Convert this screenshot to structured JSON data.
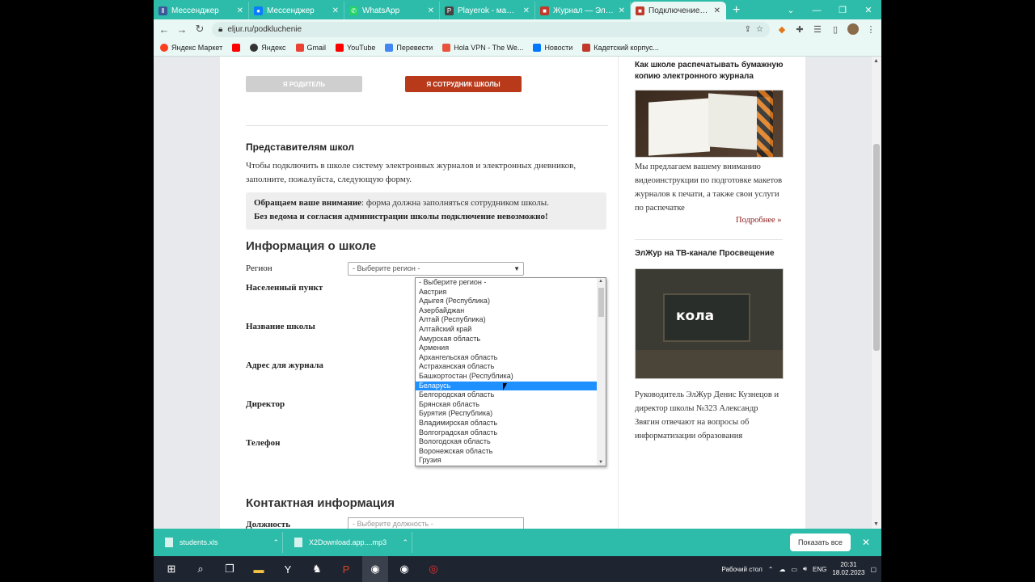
{
  "browser": {
    "tabs": [
      {
        "title": "Мессенджер",
        "color": "#3b5998"
      },
      {
        "title": "Мессенджер",
        "color": "#0a7cff"
      },
      {
        "title": "WhatsApp",
        "color": "#25d366"
      },
      {
        "title": "Playerok - маркетп",
        "color": "#444"
      },
      {
        "title": "Журнал — Электр",
        "color": "#c0392b"
      },
      {
        "title": "Подключение эле",
        "color": "#c0392b"
      }
    ],
    "url": "eljur.ru/podkluchenie",
    "bookmarks": [
      {
        "label": "Яндекс Маркет",
        "color": "#fc3f1d"
      },
      {
        "label": "",
        "color": "#ff0000"
      },
      {
        "label": "Яндекс",
        "color": "#333"
      },
      {
        "label": "Gmail",
        "color": "#ea4335"
      },
      {
        "label": "YouTube",
        "color": "#ff0000"
      },
      {
        "label": "Перевести",
        "color": "#4285f4"
      },
      {
        "label": "Hola VPN - The We...",
        "color": "#e8533b"
      },
      {
        "label": "Новости",
        "color": "#0077ff"
      },
      {
        "label": "Кадетский корпус...",
        "color": "#c0392b"
      }
    ]
  },
  "main": {
    "role_buttons": {
      "parent": "Я РОДИТЕЛЬ",
      "staff": "Я СОТРУДНИК ШКОЛЫ"
    },
    "reps_heading": "Представителям школ",
    "intro_text": "Чтобы подключить в школе систему электронных журналов и электронных дневников, заполните, пожалуйста, следующую форму.",
    "notice_bold": "Обращаем ваше внимание",
    "notice_text": ": форма должна заполняться сотрудником школы.",
    "notice_line2": "Без ведома и согласия администрации школы подключение невозможно!",
    "school_info_heading": "Информация о школе",
    "labels": {
      "region": "Регион",
      "city": "Населенный пункт",
      "school_name": "Название школы",
      "address": "Адрес для журнала",
      "director": "Директор",
      "phone": "Телефон"
    },
    "region_select_value": "- Выберите регион -",
    "region_options": [
      "- Выберите регион -",
      "Австрия",
      "Адыгея (Республика)",
      "Азербайджан",
      "Алтай (Республика)",
      "Алтайский край",
      "Амурская область",
      "Армения",
      "Архангельская область",
      "Астраханская область",
      "Башкортостан (Республика)",
      "Беларусь",
      "Белгородская область",
      "Брянская область",
      "Бурятия (Республика)",
      "Владимирская область",
      "Волгоградская область",
      "Вологодская область",
      "Воронежская область",
      "Грузия"
    ],
    "selected_option": "Беларусь",
    "contact_heading": "Контактная информация",
    "position_label": "Должность",
    "position_select_value": "- Выберите должность -"
  },
  "sidebar": {
    "print_title": "Как школе распечатывать бумажную копию электронного журнала",
    "print_text": "Мы предлагаем вашему вниманию видеоинструкции по подготовке макетов журналов к печати, а также свои услуги по распечатке",
    "more_link": "Подробнее »",
    "tv_title": "ЭлЖур на ТВ-канале Просвещение",
    "tv_image_text": "кола",
    "tv_text": "Руководитель ЭлЖур Денис Кузнецов и директор школы №323 Александр Звягин отвечают на вопросы об информатизации образования"
  },
  "downloads": {
    "items": [
      "students.xls",
      "X2Download.app....mp3"
    ],
    "show_all": "Показать все"
  },
  "taskbar": {
    "desktop_label": "Рабочий стол",
    "lang": "ENG",
    "time": "20:31",
    "date": "18.02.2023"
  }
}
